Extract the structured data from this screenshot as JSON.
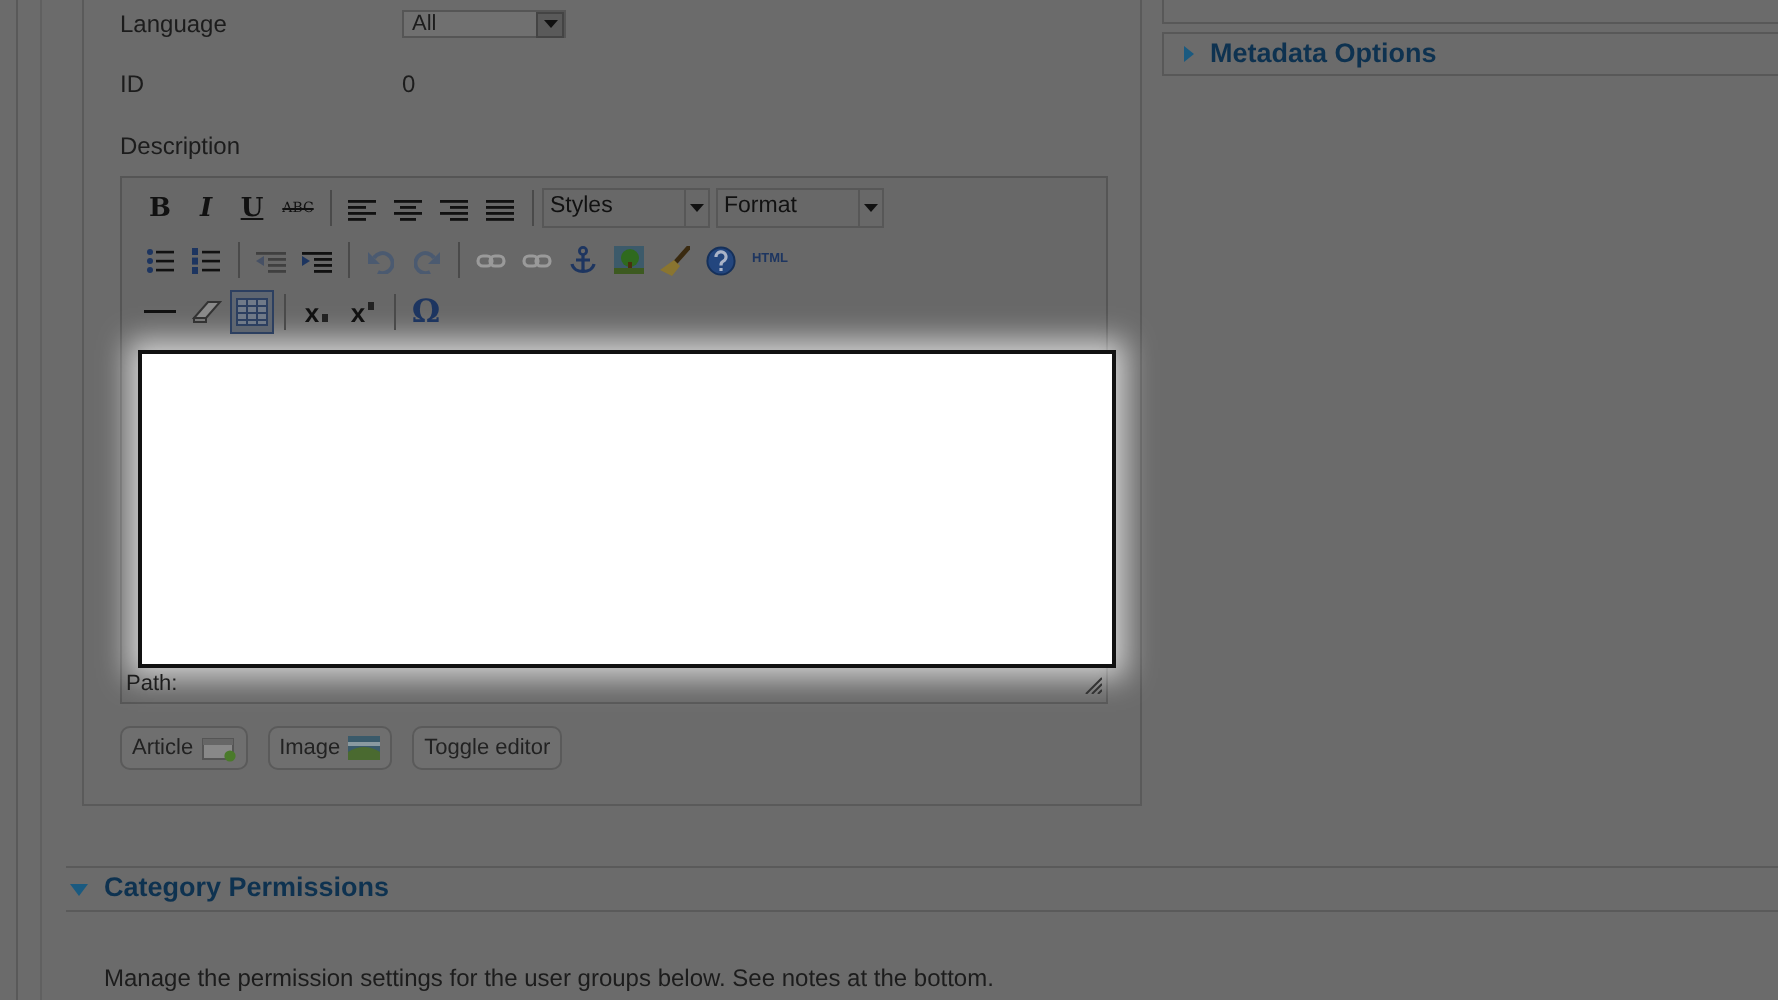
{
  "fields": [
    {
      "label": "Language",
      "value": "All",
      "kind": "select"
    },
    {
      "label": "ID",
      "value": "0",
      "kind": "text"
    }
  ],
  "description": {
    "label": "Description",
    "toolbar": [
      [
        {
          "kind": "bold",
          "text": "B",
          "disabled": false,
          "selected": false
        },
        {
          "kind": "italic",
          "text": "I",
          "disabled": false,
          "selected": false
        },
        {
          "kind": "underline",
          "text": "U",
          "disabled": false,
          "selected": false
        },
        {
          "kind": "strike",
          "text": "ABC",
          "disabled": false,
          "selected": false
        },
        {
          "kind": "sep"
        },
        {
          "kind": "align_left",
          "disabled": false,
          "selected": false
        },
        {
          "kind": "align_center",
          "disabled": false,
          "selected": false
        },
        {
          "kind": "align_right",
          "disabled": false,
          "selected": false
        },
        {
          "kind": "align_justify",
          "disabled": false,
          "selected": false
        },
        {
          "kind": "sep"
        },
        {
          "kind": "select",
          "text": "Styles"
        },
        {
          "kind": "select",
          "text": "Format"
        }
      ],
      [
        {
          "kind": "bullets",
          "disabled": false,
          "selected": false
        },
        {
          "kind": "numbers",
          "disabled": false,
          "selected": false
        },
        {
          "kind": "sep"
        },
        {
          "kind": "outdent",
          "disabled": true,
          "selected": false
        },
        {
          "kind": "indent",
          "disabled": false,
          "selected": false
        },
        {
          "kind": "sep"
        },
        {
          "kind": "undo",
          "disabled": true,
          "selected": false
        },
        {
          "kind": "redo",
          "disabled": true,
          "selected": false
        },
        {
          "kind": "sep"
        },
        {
          "kind": "link",
          "disabled": true,
          "selected": false
        },
        {
          "kind": "unlink",
          "disabled": true,
          "selected": false
        },
        {
          "kind": "anchor",
          "disabled": false,
          "selected": false
        },
        {
          "kind": "image",
          "disabled": false,
          "selected": false
        },
        {
          "kind": "cleanup",
          "disabled": false,
          "selected": false
        },
        {
          "kind": "help",
          "disabled": false,
          "selected": false
        },
        {
          "kind": "html",
          "text": "HTML",
          "disabled": false,
          "selected": false
        }
      ],
      [
        {
          "kind": "rule",
          "disabled": false,
          "selected": false
        },
        {
          "kind": "eraser",
          "disabled": false,
          "selected": false
        },
        {
          "kind": "table",
          "disabled": false,
          "selected": true
        },
        {
          "kind": "sep"
        },
        {
          "kind": "subscript",
          "text": "x",
          "disabled": false,
          "selected": false
        },
        {
          "kind": "superscript",
          "text": "x",
          "disabled": false,
          "selected": false
        },
        {
          "kind": "sep"
        },
        {
          "kind": "omega",
          "text": "Ω",
          "disabled": false,
          "selected": false
        }
      ]
    ],
    "path_label": "Path:",
    "buttons": [
      {
        "label": "Article",
        "kind": "article"
      },
      {
        "label": "Image",
        "kind": "image"
      },
      {
        "label": "Toggle editor",
        "kind": "plain"
      }
    ]
  },
  "right_panels": [
    {
      "title": "Metadata Options",
      "expanded": false
    }
  ],
  "permissions": {
    "title": "Category Permissions",
    "expanded": true,
    "text": "Manage the permission settings for the user groups below. See notes at the bottom."
  }
}
